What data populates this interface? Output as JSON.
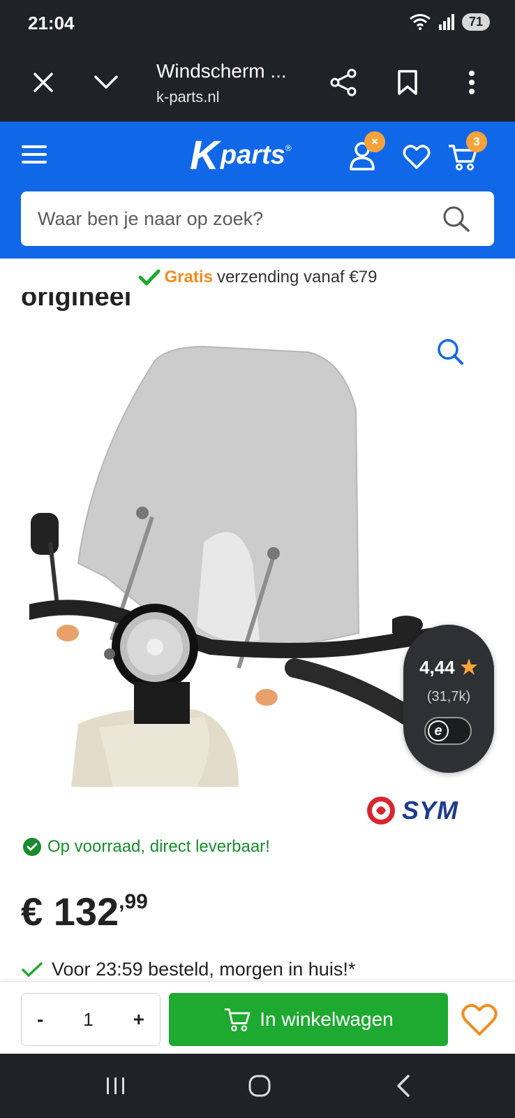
{
  "status_bar": {
    "time": "21:04",
    "battery": "71",
    "network": "6"
  },
  "browser": {
    "page_title": "Windscherm ...",
    "url": "k-parts.nl",
    "close_icon": "close-icon",
    "expand_icon": "chevron-down-icon",
    "share_icon": "share-icon",
    "bookmark_icon": "bookmark-icon",
    "menu_icon": "more-vert-icon"
  },
  "site_header": {
    "logo_k": "K",
    "logo_text": "parts",
    "account_badge": "×",
    "cart_count": "3",
    "search_placeholder": "Waar ben je naar op zoek?",
    "brand_color": "#1068e8",
    "badge_color": "#f7a23b"
  },
  "shipping_notice": {
    "highlight": "Gratis",
    "text": "verzending vanaf €79"
  },
  "product": {
    "title_fragment": "origineel",
    "brand": "SYM",
    "stock_status": "Op voorraad, direct leverbaar!",
    "price_main": "€ 132",
    "price_cents": ",99",
    "delivery_prefix": "Voor",
    "delivery_time": "23:59",
    "delivery_suffix": "besteld, morgen in huis!*"
  },
  "rating_widget": {
    "score": "4,44",
    "count": "(31,7k)",
    "trust_mark": "e"
  },
  "buy_bar": {
    "qty_minus": "-",
    "qty_value": "1",
    "qty_plus": "+",
    "add_to_cart": "In winkelwagen",
    "add_color": "#1ea930"
  }
}
